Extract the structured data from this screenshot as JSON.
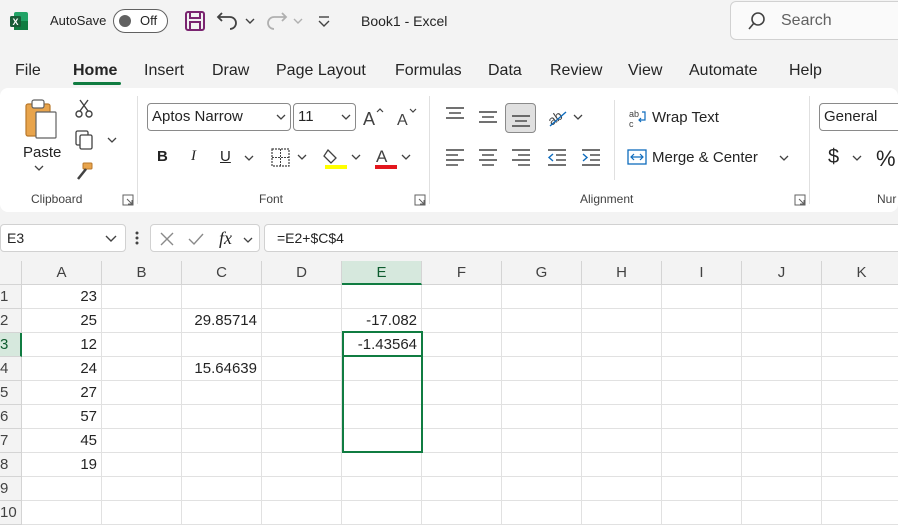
{
  "titlebar": {
    "autosave_label": "AutoSave",
    "autosave_state": "Off",
    "document_title": "Book1  -  Excel",
    "search_placeholder": "Search"
  },
  "menu": [
    "File",
    "Home",
    "Insert",
    "Draw",
    "Page Layout",
    "Formulas",
    "Data",
    "Review",
    "View",
    "Automate",
    "Help"
  ],
  "active_menu": "Home",
  "ribbon": {
    "clipboard": {
      "paste_label": "Paste",
      "group_label": "Clipboard"
    },
    "font": {
      "font_name": "Aptos Narrow",
      "font_size": "11",
      "bold": "B",
      "italic": "I",
      "underline": "U",
      "group_label": "Font"
    },
    "alignment": {
      "wrap_text": "Wrap Text",
      "merge_center": "Merge & Center",
      "group_label": "Alignment"
    },
    "number": {
      "format": "General",
      "currency": "$",
      "percent": "%",
      "group_label_partial": "Nur"
    }
  },
  "formula_bar": {
    "name_box": "E3",
    "fx": "fx",
    "formula": "=E2+$C$4"
  },
  "grid": {
    "columns": [
      "A",
      "B",
      "C",
      "D",
      "E",
      "F",
      "G",
      "H",
      "I",
      "J",
      "K"
    ],
    "rows": [
      "1",
      "2",
      "3",
      "4",
      "5",
      "6",
      "7",
      "8",
      "9",
      "10"
    ],
    "selected_column": "E",
    "selected_row": "3",
    "cells": {
      "A1": "23",
      "A2": "25",
      "A3": "12",
      "A4": "24",
      "A5": "27",
      "A6": "57",
      "A7": "45",
      "A8": "19",
      "C2": "29.85714",
      "C4": "15.64639",
      "E2": "-17.082",
      "E3": "-1.43564"
    }
  },
  "colors": {
    "accent": "#107c41",
    "ribbon_bg": "#ffffff",
    "app_bg": "#f3f3f3"
  }
}
